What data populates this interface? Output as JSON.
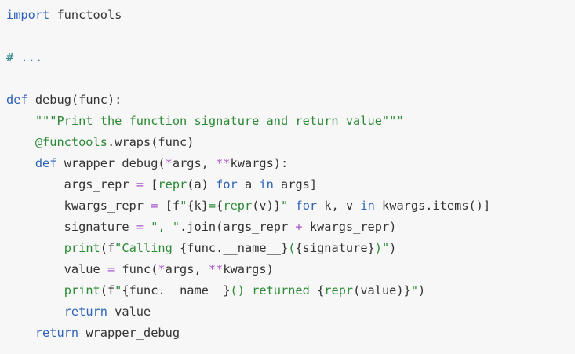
{
  "code_block": {
    "language": "python",
    "colors": {
      "background": "#f7f7f7",
      "default_text": "#333333",
      "keyword": "#2e63b8",
      "comment": "#2a7f86",
      "string": "#2c8a36",
      "operator": "#a857c8"
    },
    "lines": [
      [
        {
          "t": "import",
          "c": "kw"
        },
        {
          "t": " functools",
          "c": "name"
        }
      ],
      [],
      [
        {
          "t": "# ...",
          "c": "cmt"
        }
      ],
      [],
      [
        {
          "t": "def",
          "c": "kw"
        },
        {
          "t": " debug(func):",
          "c": "name"
        }
      ],
      [
        {
          "t": "    ",
          "c": "name"
        },
        {
          "t": "\"\"\"Print the function signature and return value\"\"\"",
          "c": "str"
        }
      ],
      [
        {
          "t": "    ",
          "c": "name"
        },
        {
          "t": "@functools",
          "c": "dec"
        },
        {
          "t": ".wraps(func)",
          "c": "name"
        }
      ],
      [
        {
          "t": "    ",
          "c": "name"
        },
        {
          "t": "def",
          "c": "kw"
        },
        {
          "t": " wrapper_debug(",
          "c": "name"
        },
        {
          "t": "*",
          "c": "op"
        },
        {
          "t": "args, ",
          "c": "name"
        },
        {
          "t": "**",
          "c": "op"
        },
        {
          "t": "kwargs):",
          "c": "name"
        }
      ],
      [
        {
          "t": "        args_repr ",
          "c": "name"
        },
        {
          "t": "=",
          "c": "op"
        },
        {
          "t": " [",
          "c": "name"
        },
        {
          "t": "repr",
          "c": "bi"
        },
        {
          "t": "(a) ",
          "c": "name"
        },
        {
          "t": "for",
          "c": "kw"
        },
        {
          "t": " a ",
          "c": "name"
        },
        {
          "t": "in",
          "c": "kw"
        },
        {
          "t": " args]",
          "c": "name"
        }
      ],
      [
        {
          "t": "        kwargs_repr ",
          "c": "name"
        },
        {
          "t": "=",
          "c": "op"
        },
        {
          "t": " [f",
          "c": "name"
        },
        {
          "t": "\"",
          "c": "str"
        },
        {
          "t": "{k}",
          "c": "name"
        },
        {
          "t": "=",
          "c": "str"
        },
        {
          "t": "{",
          "c": "name"
        },
        {
          "t": "repr",
          "c": "bi"
        },
        {
          "t": "(v)}",
          "c": "name"
        },
        {
          "t": "\"",
          "c": "str"
        },
        {
          "t": " ",
          "c": "name"
        },
        {
          "t": "for",
          "c": "kw"
        },
        {
          "t": " k, v ",
          "c": "name"
        },
        {
          "t": "in",
          "c": "kw"
        },
        {
          "t": " kwargs.items()]",
          "c": "name"
        }
      ],
      [
        {
          "t": "        signature ",
          "c": "name"
        },
        {
          "t": "=",
          "c": "op"
        },
        {
          "t": " ",
          "c": "name"
        },
        {
          "t": "\", \"",
          "c": "str"
        },
        {
          "t": ".join(args_repr ",
          "c": "name"
        },
        {
          "t": "+",
          "c": "op"
        },
        {
          "t": " kwargs_repr)",
          "c": "name"
        }
      ],
      [
        {
          "t": "        ",
          "c": "name"
        },
        {
          "t": "print",
          "c": "bi"
        },
        {
          "t": "(f",
          "c": "name"
        },
        {
          "t": "\"Calling ",
          "c": "str"
        },
        {
          "t": "{func.__name__}",
          "c": "name"
        },
        {
          "t": "(",
          "c": "str"
        },
        {
          "t": "{signature}",
          "c": "name"
        },
        {
          "t": ")\"",
          "c": "str"
        },
        {
          "t": ")",
          "c": "name"
        }
      ],
      [
        {
          "t": "        value ",
          "c": "name"
        },
        {
          "t": "=",
          "c": "op"
        },
        {
          "t": " func(",
          "c": "name"
        },
        {
          "t": "*",
          "c": "op"
        },
        {
          "t": "args, ",
          "c": "name"
        },
        {
          "t": "**",
          "c": "op"
        },
        {
          "t": "kwargs)",
          "c": "name"
        }
      ],
      [
        {
          "t": "        ",
          "c": "name"
        },
        {
          "t": "print",
          "c": "bi"
        },
        {
          "t": "(f",
          "c": "name"
        },
        {
          "t": "\"",
          "c": "str"
        },
        {
          "t": "{func.__name__}",
          "c": "name"
        },
        {
          "t": "() returned ",
          "c": "str"
        },
        {
          "t": "{",
          "c": "name"
        },
        {
          "t": "repr",
          "c": "bi"
        },
        {
          "t": "(value)}",
          "c": "name"
        },
        {
          "t": "\"",
          "c": "str"
        },
        {
          "t": ")",
          "c": "name"
        }
      ],
      [
        {
          "t": "        ",
          "c": "name"
        },
        {
          "t": "return",
          "c": "kw"
        },
        {
          "t": " value",
          "c": "name"
        }
      ],
      [
        {
          "t": "    ",
          "c": "name"
        },
        {
          "t": "return",
          "c": "kw"
        },
        {
          "t": " wrapper_debug",
          "c": "name"
        }
      ]
    ]
  }
}
